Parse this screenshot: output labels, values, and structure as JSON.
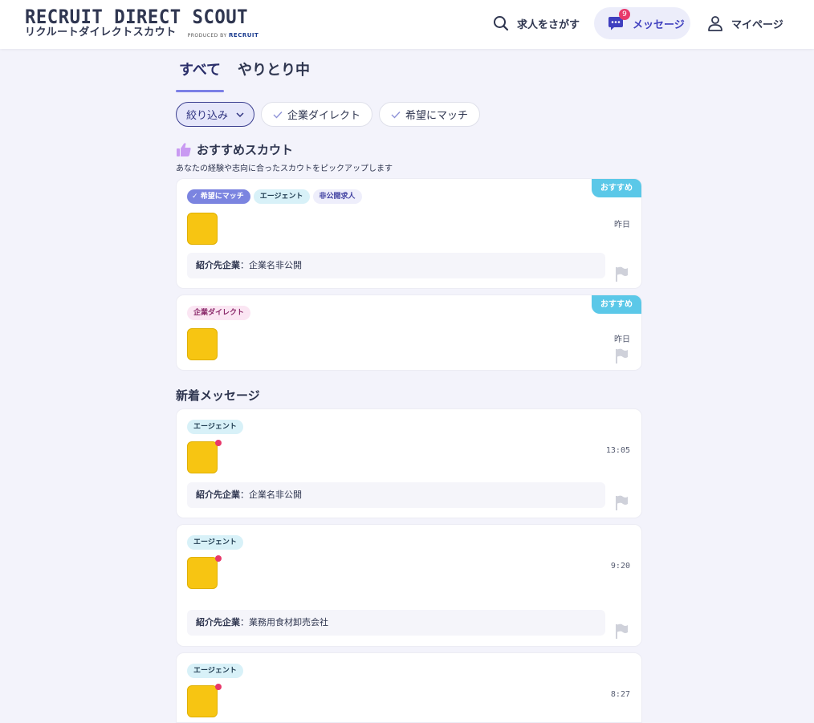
{
  "header": {
    "logo_main": "RECRUIT DIRECT SCOUT",
    "logo_sub": "リクルートダイレクトスカウト",
    "logo_produced": "PRODUCED BY",
    "logo_brand": "RECRUIT",
    "nav": {
      "search_label": "求人をさがす",
      "messages_label": "メッセージ",
      "messages_badge": "9",
      "mypage_label": "マイページ"
    }
  },
  "tabs": [
    {
      "label": "すべて",
      "active": true
    },
    {
      "label": "やりとり中",
      "active": false
    }
  ],
  "filters": {
    "narrow_label": "絞り込み",
    "chips": [
      "企業ダイレクト",
      "希望にマッチ"
    ]
  },
  "recommended": {
    "title": "おすすめスカウト",
    "description": "あなたの経験や志向に合ったスカウトをピックアップします",
    "cards": [
      {
        "ribbon": "おすすめ",
        "tags": [
          "希望にマッチ",
          "エージェント",
          "非公開求人"
        ],
        "time": "昨日",
        "intro_label": "紹介先企業",
        "intro_value": "：企業名非公開"
      },
      {
        "ribbon": "おすすめ",
        "tags": [
          "企業ダイレクト"
        ],
        "time": "昨日"
      }
    ]
  },
  "new_messages": {
    "title": "新着メッセージ",
    "cards": [
      {
        "tag": "エージェント",
        "time": "13:05",
        "intro_label": "紹介先企業",
        "intro_value": "：企業名非公開"
      },
      {
        "tag": "エージェント",
        "time": "9:20",
        "intro_label": "紹介先企業",
        "intro_value": "：業務用食材卸売会社"
      },
      {
        "tag": "エージェント",
        "time": "8:27"
      }
    ]
  },
  "colors": {
    "accent": "#7b7fe6",
    "ribbon": "#5bc8e8",
    "badge": "#e8386a",
    "avatar": "#f7c512"
  }
}
